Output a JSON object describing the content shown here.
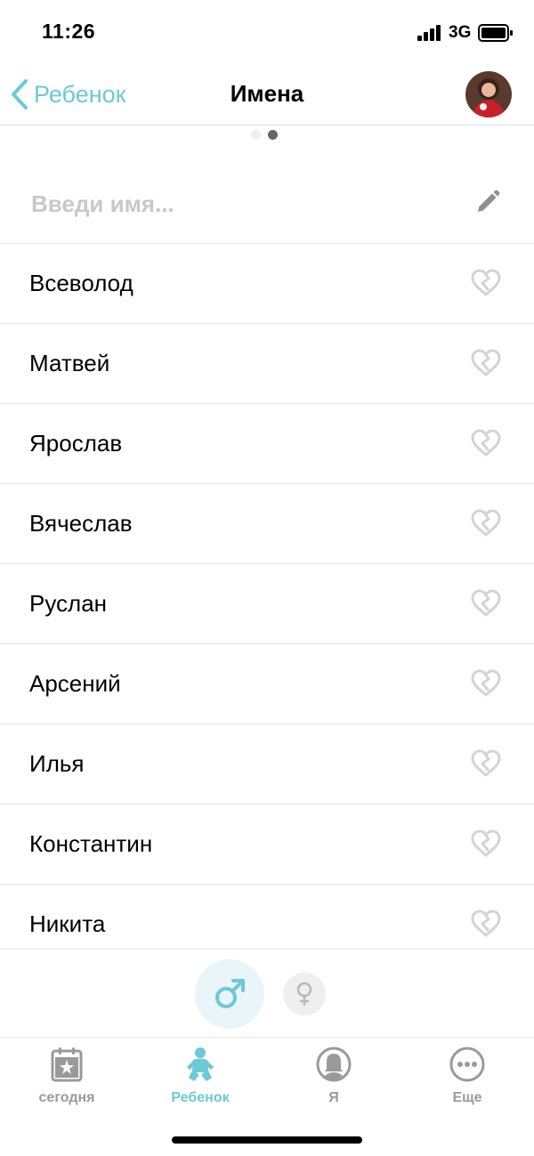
{
  "status_bar": {
    "time": "11:26",
    "network": "3G"
  },
  "nav": {
    "back_label": "Ребенок",
    "title": "Имена"
  },
  "pager": {
    "pages": 2,
    "active_index": 1
  },
  "name_input": {
    "placeholder": "Введи имя...",
    "value": ""
  },
  "names": [
    "Всеволод",
    "Матвей",
    "Ярослав",
    "Вячеслав",
    "Руслан",
    "Арсений",
    "Илья",
    "Константин",
    "Никита"
  ],
  "gender_toggle": {
    "selected": "male",
    "options": [
      "male-symbol-icon",
      "female-symbol-icon"
    ]
  },
  "tabs": [
    {
      "label": "сегодня",
      "icon": "calendar-star-icon",
      "active": false
    },
    {
      "label": "Ребенок",
      "icon": "baby-icon",
      "active": true
    },
    {
      "label": "Я",
      "icon": "woman-icon",
      "active": false
    },
    {
      "label": "Еще",
      "icon": "more-dots-icon",
      "active": false
    }
  ],
  "colors": {
    "accent": "#6dc8d8",
    "inactive": "#9a9a9a",
    "heart_outline": "#d4d4d4",
    "divider": "#e3e3e3"
  }
}
